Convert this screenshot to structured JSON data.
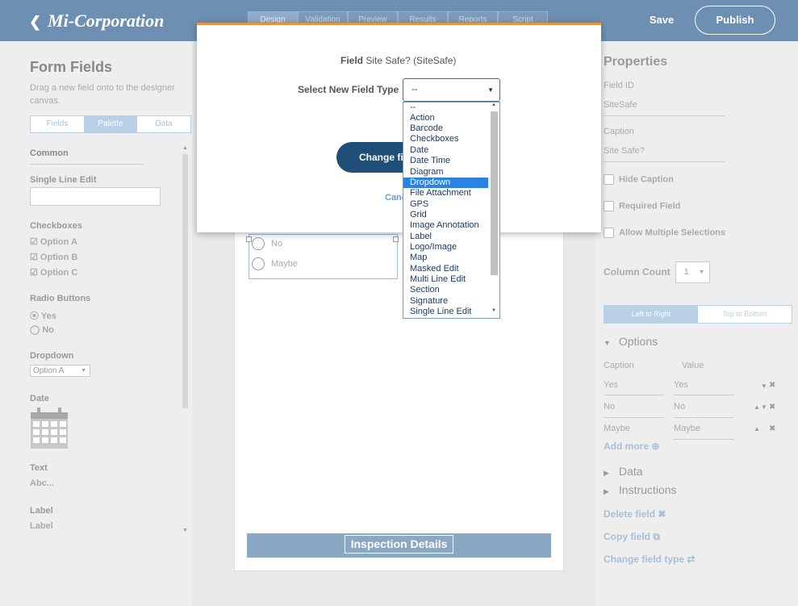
{
  "app": {
    "logo": "Mi-Corporation",
    "back_icon": "chevron-left-icon"
  },
  "top_tabs": [
    "Design",
    "Validation",
    "Preview",
    "Results",
    "Reports",
    "Script"
  ],
  "header": {
    "save_label": "Save",
    "publish_label": "Publish"
  },
  "left_panel": {
    "title": "Form Fields",
    "subtitle": "Drag a new field onto to the designer canvas.",
    "tabs": [
      "Fields",
      "Palette",
      "Data"
    ],
    "active_tab": "Palette",
    "common_label": "Common",
    "single_line_label": "Single Line Edit",
    "checkboxes_label": "Checkboxes",
    "checkbox_options": [
      "☑ Option A",
      "☑ Option B",
      "☑ Option C"
    ],
    "radio_label": "Radio Buttons",
    "radio_options": [
      "⦿ Yes",
      "◯ No"
    ],
    "dropdown_label": "Dropdown",
    "dropdown_value": "Option A",
    "date_label": "Date",
    "text_label": "Text",
    "text_value": "Abc...",
    "label_label": "Label",
    "label_value": "Label"
  },
  "canvas": {
    "radio_options": [
      "No",
      "Maybe"
    ],
    "section_title": "Inspection Details"
  },
  "right_panel": {
    "title": "Properties",
    "field_id_label": "Field ID",
    "field_id_value": "SiteSafe",
    "caption_label": "Caption",
    "caption_value": "Site Safe?",
    "hide_caption": "Hide Caption",
    "required_field": "Required Field",
    "allow_multiple": "Allow Multiple Selections",
    "column_count_label": "Column Count",
    "column_count_value": "1",
    "direction_tabs": [
      "Left to Right",
      "Top to Bottom"
    ],
    "options_label": "Options",
    "caption_col": "Caption",
    "value_col": "Value",
    "options": [
      {
        "caption": "Yes",
        "value": "Yes"
      },
      {
        "caption": "No",
        "value": "No"
      },
      {
        "caption": "Maybe",
        "value": "Maybe"
      }
    ],
    "add_more": "Add more ⊕",
    "data_label": "Data",
    "instructions_label": "Instructions",
    "delete_field": "Delete field ✖",
    "copy_field": "Copy field ⧉",
    "change_field_type": "Change field type ⇄"
  },
  "modal": {
    "field_prefix": "Field",
    "field_name": "Site Safe? (SiteSafe)",
    "select_label": "Select New Field Type",
    "select_value": "--",
    "change_button": "Change field type",
    "cancel_link": "Cancel",
    "options": [
      "--",
      "Action",
      "Barcode",
      "Checkboxes",
      "Date",
      "Date Time",
      "Diagram",
      "Dropdown",
      "File Attachment",
      "GPS",
      "Grid",
      "Image Annotation",
      "Label",
      "Logo/Image",
      "Map",
      "Masked Edit",
      "Multi Line Edit",
      "Section",
      "Signature",
      "Single Line Edit"
    ],
    "highlighted": "Dropdown"
  },
  "colors": {
    "header": "#6d8fb1",
    "modal_accent": "#e8923a",
    "highlight": "#2a82e4",
    "button": "#1f4e79"
  }
}
